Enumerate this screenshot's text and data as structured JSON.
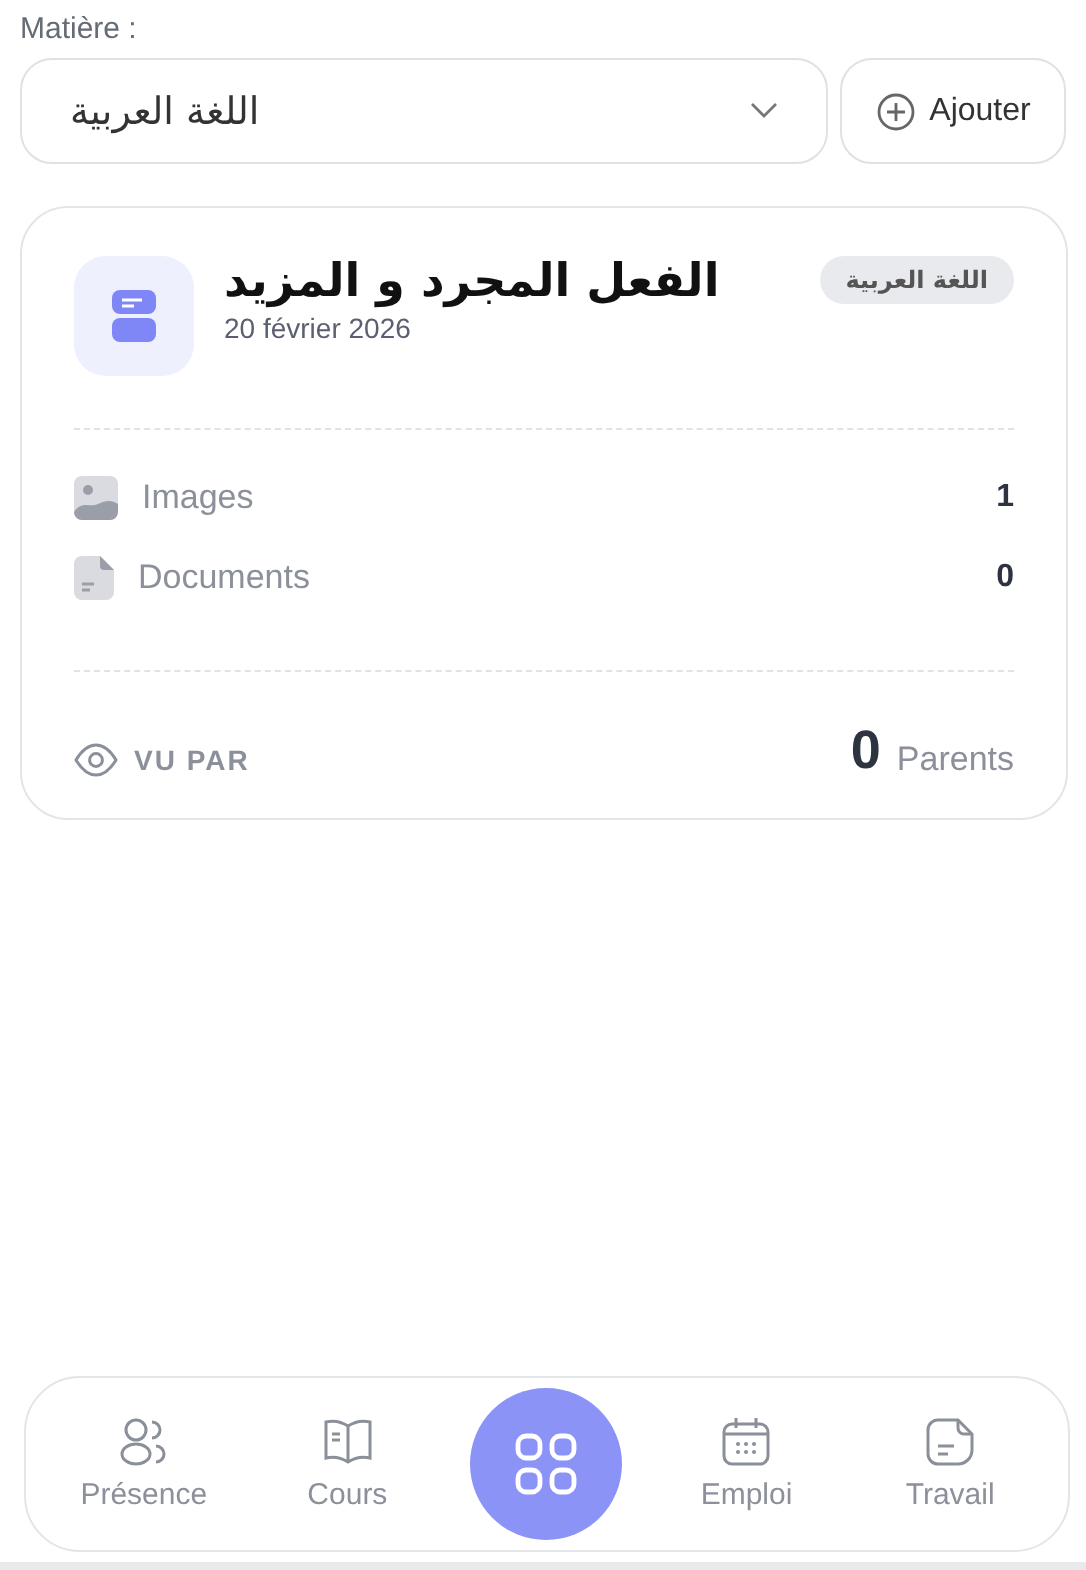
{
  "subject_picker": {
    "label": "Matière :",
    "value": "اللغة العربية",
    "add_button": "Ajouter"
  },
  "lesson": {
    "title": "الفعل المجرد و المزيد",
    "date": "20 février 2026",
    "subject_tag": "اللغة العربية",
    "attachments": [
      {
        "kind": "image",
        "label": "Images",
        "count": "1"
      },
      {
        "kind": "document",
        "label": "Documents",
        "count": "0"
      }
    ],
    "seen_by": {
      "label": "VU PAR",
      "count": "0",
      "unit": "Parents"
    }
  },
  "nav": [
    {
      "kind": "people",
      "label": "Présence"
    },
    {
      "kind": "book",
      "label": "Cours"
    },
    {
      "kind": "center"
    },
    {
      "kind": "calendar",
      "label": "Emploi"
    },
    {
      "kind": "note",
      "label": "Travail"
    }
  ]
}
